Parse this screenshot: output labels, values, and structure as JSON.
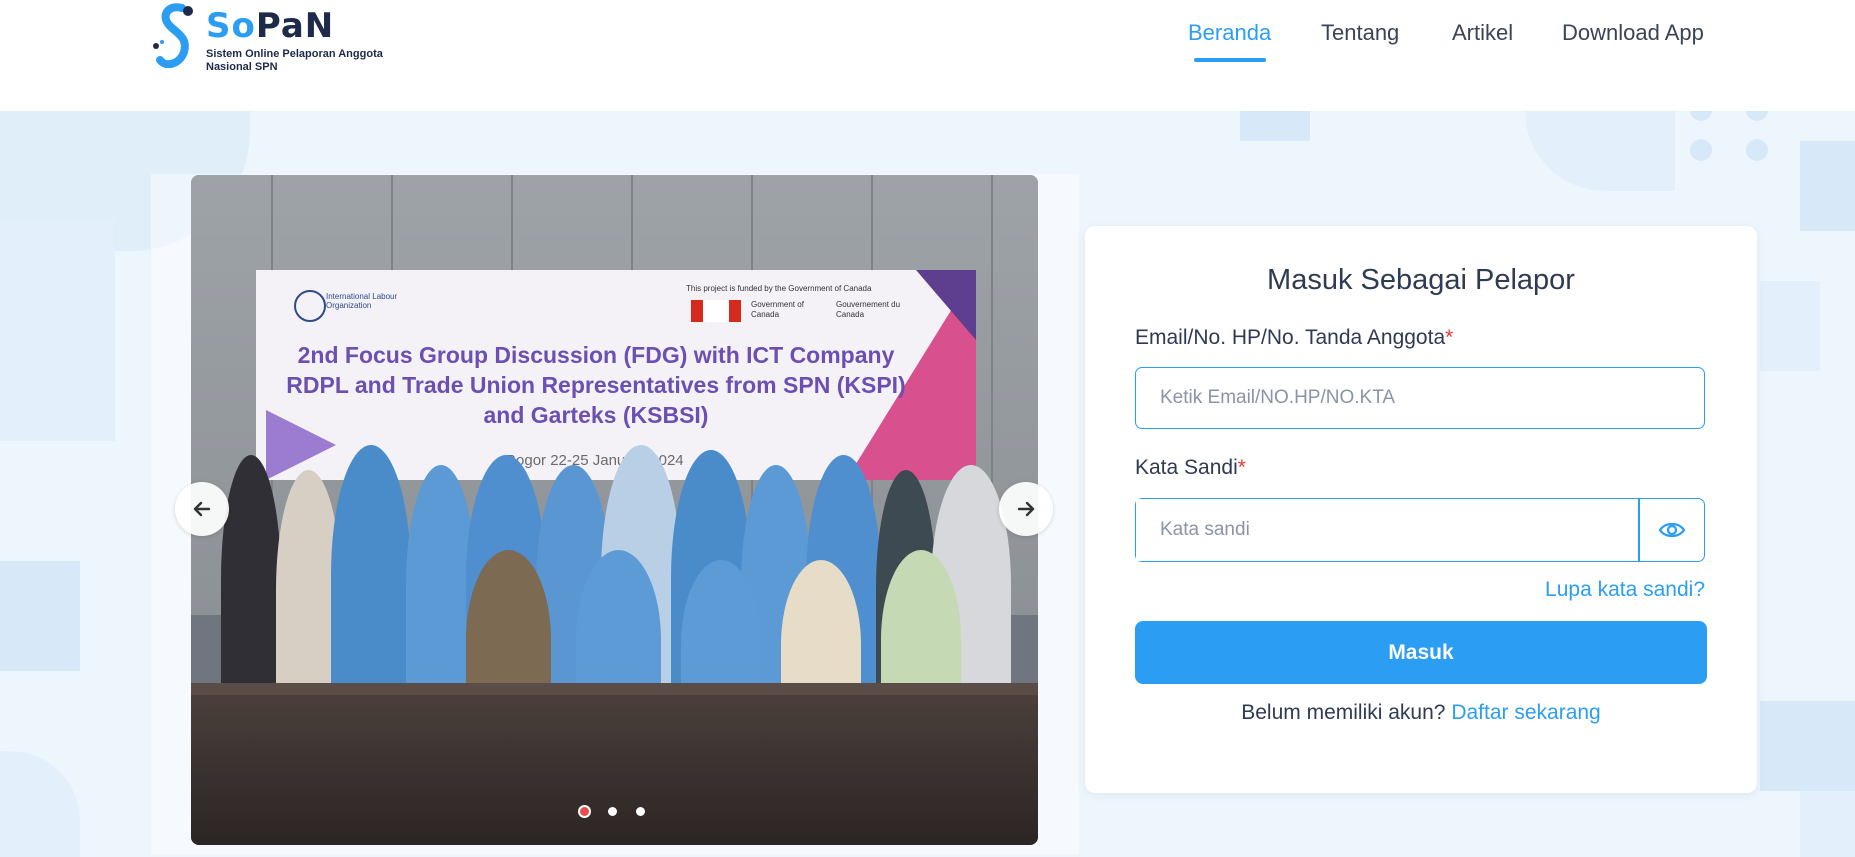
{
  "brand": {
    "name_part1": "So",
    "name_part2": "PaN",
    "tagline": "Sistem Online Pelaporan Anggota Nasional SPN"
  },
  "nav": {
    "items": [
      {
        "label": "Beranda",
        "active": true
      },
      {
        "label": "Tentang",
        "active": false
      },
      {
        "label": "Artikel",
        "active": false
      },
      {
        "label": "Download App",
        "active": false
      }
    ]
  },
  "carousel": {
    "slide": {
      "banner_org": "International Labour Organization",
      "banner_funding": "This project is funded by the Government of Canada",
      "banner_gov_en": "Government of Canada",
      "banner_gov_fr": "Gouvernement du Canada",
      "banner_title": "2nd Focus Group Discussion (FDG) with ICT Company RDPL and Trade Union Representatives from SPN (KSPI) and Garteks (KSBSI)",
      "banner_location": "Bogor 22-25 January 2024"
    },
    "prev_icon": "arrow-left",
    "next_icon": "arrow-right",
    "slide_count": 3,
    "active_index": 0
  },
  "login": {
    "title": "Masuk Sebagai Pelapor",
    "identity_label": "Email/No. HP/No. Tanda Anggota",
    "identity_placeholder": "Ketik Email/NO.HP/NO.KTA",
    "password_label": "Kata Sandi",
    "password_placeholder": "Kata sandi",
    "required_mark": "*",
    "forgot_label": "Lupa kata sandi?",
    "submit_label": "Masuk",
    "register_prompt": "Belum memiliki akun?",
    "register_link": "Daftar sekarang"
  },
  "colors": {
    "accent": "#2b9ef3",
    "required": "#e53935",
    "hero_bg": "#eef6fd"
  }
}
